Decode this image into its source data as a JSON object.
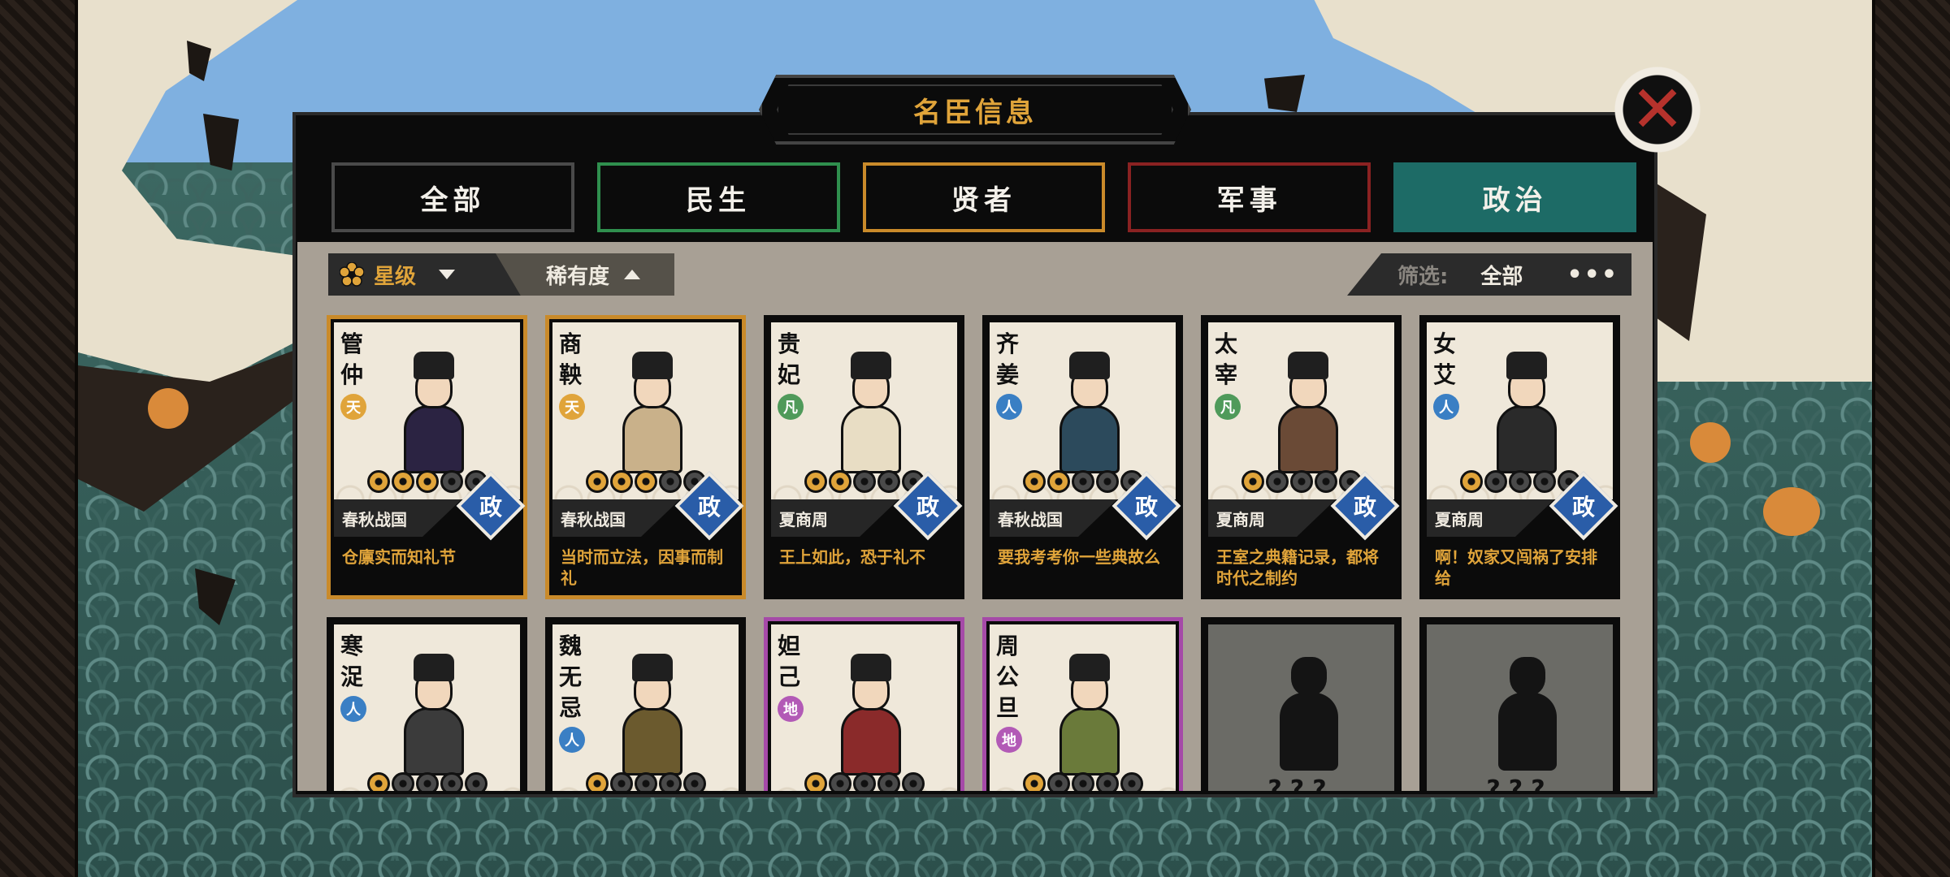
{
  "panel": {
    "title": "名臣信息"
  },
  "tabs": [
    {
      "label": "全部"
    },
    {
      "label": "民生"
    },
    {
      "label": "贤者"
    },
    {
      "label": "军事"
    },
    {
      "label": "政治"
    }
  ],
  "filters": {
    "sort_star_label": "星级",
    "sort_rarity_label": "稀有度",
    "filter_label": "筛选:",
    "filter_value": "全部",
    "more": "•••"
  },
  "cards": [
    {
      "name": "管仲",
      "rank": "天",
      "era": "春秋战国",
      "stars": 3,
      "badge": "政",
      "quote": "仓廪实而知礼节",
      "frame": "gold"
    },
    {
      "name": "商鞅",
      "rank": "天",
      "era": "春秋战国",
      "stars": 3,
      "badge": "政",
      "quote": "当时而立法，因事而制礼",
      "frame": "gold"
    },
    {
      "name": "贵妃",
      "rank": "凡",
      "era": "夏商周",
      "stars": 2,
      "badge": "政",
      "quote": "王上如此，恐于礼不",
      "frame": "plain"
    },
    {
      "name": "齐姜",
      "rank": "人",
      "era": "春秋战国",
      "stars": 2,
      "badge": "政",
      "quote": "要我考考你一些典故么",
      "frame": "plain"
    },
    {
      "name": "太宰",
      "rank": "凡",
      "era": "夏商周",
      "stars": 1,
      "badge": "政",
      "quote": "王室之典籍记录，都将时代之制约",
      "frame": "plain"
    },
    {
      "name": "女艾",
      "rank": "人",
      "era": "夏商周",
      "stars": 1,
      "badge": "政",
      "quote": "啊！奴家又闯祸了安排给",
      "frame": "plain"
    },
    {
      "name": "寒浞",
      "rank": "人",
      "stars": 1,
      "frame": "plain"
    },
    {
      "name": "魏无忌",
      "rank": "人",
      "stars": 1,
      "frame": "plain"
    },
    {
      "name": "妲己",
      "rank": "地",
      "stars": 1,
      "frame": "purple"
    },
    {
      "name": "周公旦",
      "rank": "地",
      "stars": 1,
      "frame": "purple"
    },
    {
      "locked": true,
      "text": "???"
    },
    {
      "locked": true,
      "text": "???"
    }
  ],
  "colors": {
    "gold": "#e0a43a",
    "politics_tab": "#1d6b66",
    "minsheng_border": "#2f8f4e",
    "sage_border": "#c98a2a",
    "military_border": "#8a2222",
    "purple_frame": "#a54aa8",
    "zheng_badge": "#2a5da8"
  },
  "icons": {
    "close": "close-x-icon",
    "star_sort": "flower-icon",
    "dropdown": "triangle-down-icon",
    "sort_up": "triangle-up-icon",
    "more": "more-dots-icon"
  }
}
